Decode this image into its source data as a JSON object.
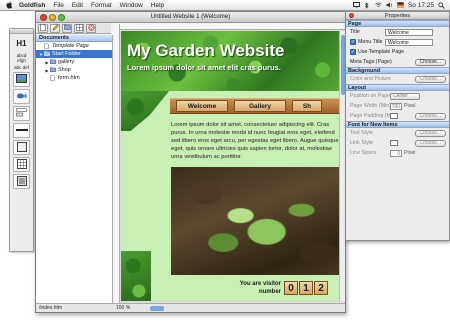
{
  "menubar": {
    "app_name": "Goldfish",
    "items": [
      "File",
      "Edit",
      "Format",
      "Window",
      "Help"
    ],
    "clock": "So 17:25"
  },
  "palette": {
    "heading_tool": "H1",
    "text_tool_1": "abcd efgh",
    "text_tool_2": "abc def"
  },
  "document": {
    "window_title": "Untitled Website 1 (Welcome)",
    "sidebar_title": "Documents",
    "tree": [
      {
        "label": "Template Page",
        "italic": true
      },
      {
        "label": "Start Folder",
        "selected": true
      },
      {
        "label": "gallery"
      },
      {
        "label": "Shop"
      },
      {
        "label": "form.htm"
      }
    ],
    "status_path": "/index.htm",
    "zoom": "100 %"
  },
  "webpage": {
    "title": "My Garden Website",
    "subtitle": "Lorem ipsum dolor sit amet elit cras purus.",
    "nav": [
      "Welcome",
      "Gallery",
      "Sh"
    ],
    "body": "Lorem ipsum dolor sit amet, consectetuer adipiscing elit. Cras purus. In urna molestie morbi id nunc feugiat eros eget, eleifend sed libero eros eget arcu, per egestas eget libero. Augue quisque eget, quis ornare ultricies quis sapien tortor, dolor at, molestiae urna vestibulum ac porttitor.",
    "visitor_label": "You are visitor number",
    "counter_digits": [
      "0",
      "1",
      "2"
    ]
  },
  "properties": {
    "window_title": "Properties",
    "page_section": "Page",
    "title_label": "Title",
    "title_value": "Welcome",
    "menu_title_label": "Menu Title",
    "menu_title_value": "Welcome",
    "use_template_label": "Use Template Page",
    "meta_tags_label": "Meta Tags (Page)",
    "choose": "Choose...",
    "background_section": "Background",
    "color_picture_label": "Color and Picture",
    "layout_section": "Layout",
    "position_label": "Position on Page",
    "position_value": "Center",
    "width_label": "Page Width (Min)",
    "width_value": "780",
    "padding_label": "Page Padding (Min)",
    "pixel_unit": "Pixel",
    "font_section": "Font for New Items",
    "text_style_label": "Text Style",
    "link_style_label": "Link Style",
    "line_space_label": "Line Space",
    "line_space_value": "0"
  }
}
